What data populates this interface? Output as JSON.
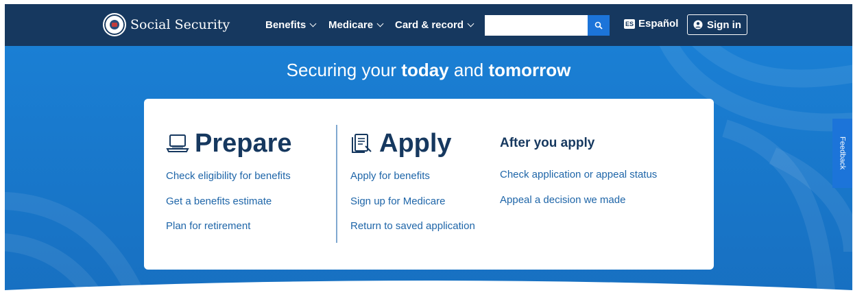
{
  "header": {
    "logo_text": "Social Security",
    "nav": [
      {
        "label": "Benefits"
      },
      {
        "label": "Medicare"
      },
      {
        "label": "Card & record"
      }
    ],
    "search": {
      "placeholder": "",
      "value": ""
    },
    "lang_badge": "ES",
    "lang_label": "Español",
    "signin_label": "Sign in"
  },
  "hero": {
    "title_part1": "Securing your ",
    "title_bold1": "today",
    "title_part2": " and ",
    "title_bold2": "tomorrow"
  },
  "card": {
    "prepare": {
      "heading": "Prepare",
      "links": [
        "Check eligibility for benefits",
        "Get a benefits estimate",
        "Plan for retirement"
      ]
    },
    "apply": {
      "heading": "Apply",
      "links": [
        "Apply for benefits",
        "Sign up for Medicare",
        "Return to saved application"
      ]
    },
    "after": {
      "heading": "After you apply",
      "links": [
        "Check application or appeal status",
        "Appeal a decision we made"
      ]
    }
  },
  "feedback_label": "Feedback",
  "colors": {
    "header_bg": "#16385f",
    "hero_bg": "#1a7fd4",
    "link": "#1e65a8",
    "accent": "#1c74d9"
  }
}
